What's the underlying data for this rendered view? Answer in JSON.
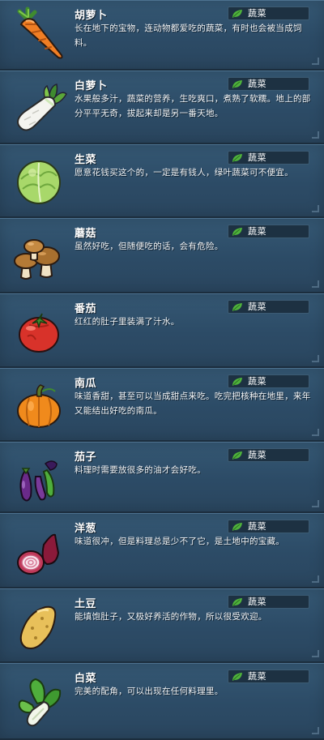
{
  "category_label": "蔬菜",
  "category_icon": "leaf-icon",
  "items": [
    {
      "name": "胡萝卜",
      "icon": "carrot-icon",
      "desc": "长在地下的宝物，连动物都爱吃的蔬菜，有时也会被当成饲料。"
    },
    {
      "name": "白萝卜",
      "icon": "daikon-radish-icon",
      "desc": "水果般多汁，蔬菜的营养，生吃爽口，煮熟了软糯。地上的部分平平无奇，拔起来却是另一番天地。"
    },
    {
      "name": "生菜",
      "icon": "lettuce-icon",
      "desc": "愿意花钱买这个的，一定是有钱人，绿叶蔬菜可不便宜。"
    },
    {
      "name": "蘑菇",
      "icon": "mushroom-icon",
      "desc": "虽然好吃，但随便吃的话，会有危险。"
    },
    {
      "name": "番茄",
      "icon": "tomato-icon",
      "desc": "红红的肚子里装满了汁水。"
    },
    {
      "name": "南瓜",
      "icon": "pumpkin-icon",
      "desc": "味道香甜，甚至可以当成甜点来吃。吃完把核种在地里，来年又能结出好吃的南瓜。"
    },
    {
      "name": "茄子",
      "icon": "eggplant-icon",
      "desc": "料理时需要放很多的油才会好吃。"
    },
    {
      "name": "洋葱",
      "icon": "onion-icon",
      "desc": "味道很冲，但是料理总是少不了它，是土地中的宝藏。"
    },
    {
      "name": "土豆",
      "icon": "potato-icon",
      "desc": "能填饱肚子，又极好养活的作物，所以很受欢迎。"
    },
    {
      "name": "白菜",
      "icon": "bok-choy-icon",
      "desc": "完美的配角，可以出现在任何料理里。"
    }
  ]
}
